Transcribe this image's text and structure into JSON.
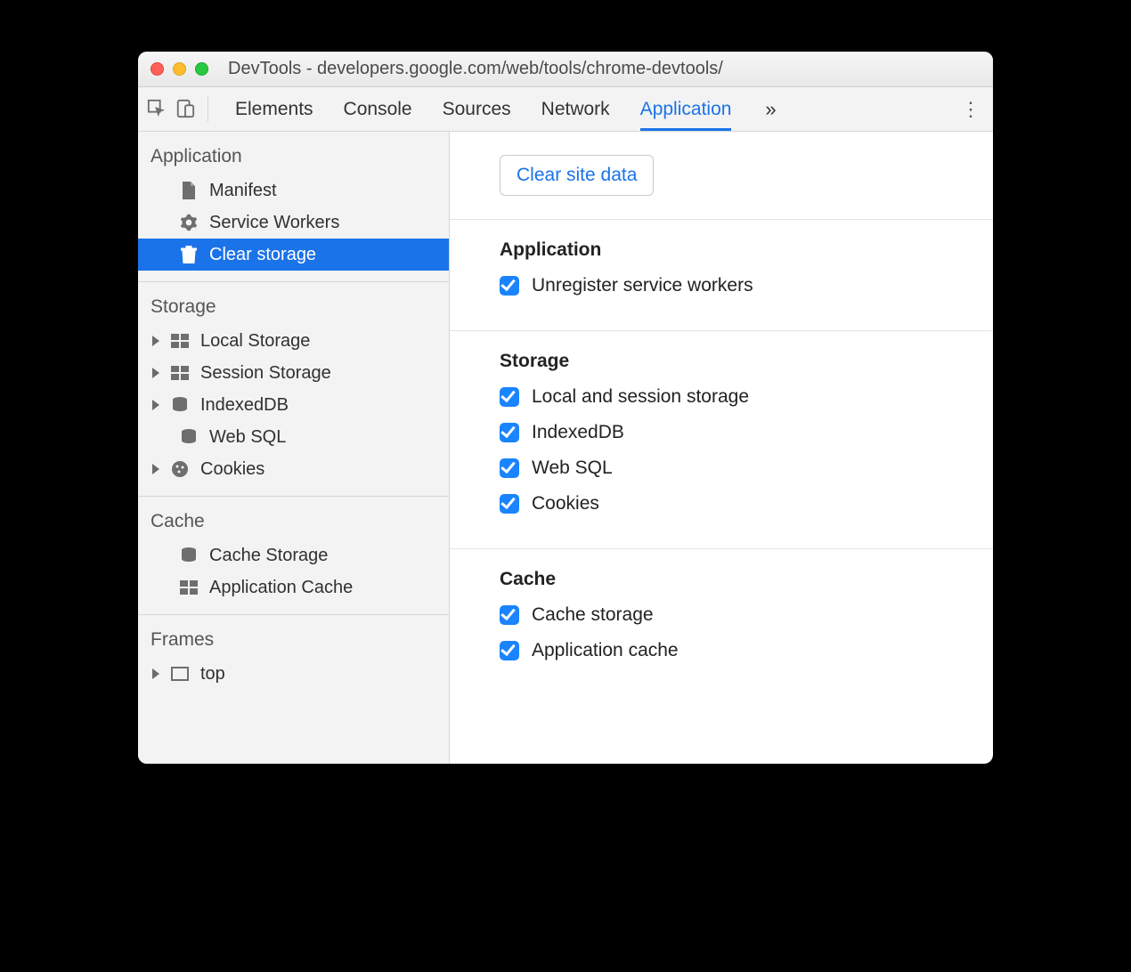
{
  "window": {
    "title": "DevTools - developers.google.com/web/tools/chrome-devtools/"
  },
  "tabs": {
    "items": [
      "Elements",
      "Console",
      "Sources",
      "Network",
      "Application"
    ],
    "active_index": 4,
    "overflow_glyph": "»"
  },
  "sidebar": {
    "groups": [
      {
        "title": "Application",
        "items": [
          {
            "label": "Manifest",
            "icon": "file",
            "expandable": false,
            "selected": false
          },
          {
            "label": "Service Workers",
            "icon": "gear",
            "expandable": false,
            "selected": false
          },
          {
            "label": "Clear storage",
            "icon": "trash",
            "expandable": false,
            "selected": true
          }
        ]
      },
      {
        "title": "Storage",
        "items": [
          {
            "label": "Local Storage",
            "icon": "grid",
            "expandable": true,
            "selected": false
          },
          {
            "label": "Session Storage",
            "icon": "grid",
            "expandable": true,
            "selected": false
          },
          {
            "label": "IndexedDB",
            "icon": "db",
            "expandable": true,
            "selected": false
          },
          {
            "label": "Web SQL",
            "icon": "db",
            "expandable": false,
            "selected": false
          },
          {
            "label": "Cookies",
            "icon": "cookie",
            "expandable": true,
            "selected": false
          }
        ]
      },
      {
        "title": "Cache",
        "items": [
          {
            "label": "Cache Storage",
            "icon": "db",
            "expandable": false,
            "selected": false
          },
          {
            "label": "Application Cache",
            "icon": "grid",
            "expandable": false,
            "selected": false
          }
        ]
      },
      {
        "title": "Frames",
        "items": [
          {
            "label": "top",
            "icon": "frame",
            "expandable": true,
            "selected": false
          }
        ]
      }
    ]
  },
  "main": {
    "clear_button": "Clear site data",
    "sections": [
      {
        "title": "Application",
        "checks": [
          {
            "label": "Unregister service workers",
            "checked": true
          }
        ]
      },
      {
        "title": "Storage",
        "checks": [
          {
            "label": "Local and session storage",
            "checked": true
          },
          {
            "label": "IndexedDB",
            "checked": true
          },
          {
            "label": "Web SQL",
            "checked": true
          },
          {
            "label": "Cookies",
            "checked": true
          }
        ]
      },
      {
        "title": "Cache",
        "checks": [
          {
            "label": "Cache storage",
            "checked": true
          },
          {
            "label": "Application cache",
            "checked": true
          }
        ]
      }
    ]
  }
}
